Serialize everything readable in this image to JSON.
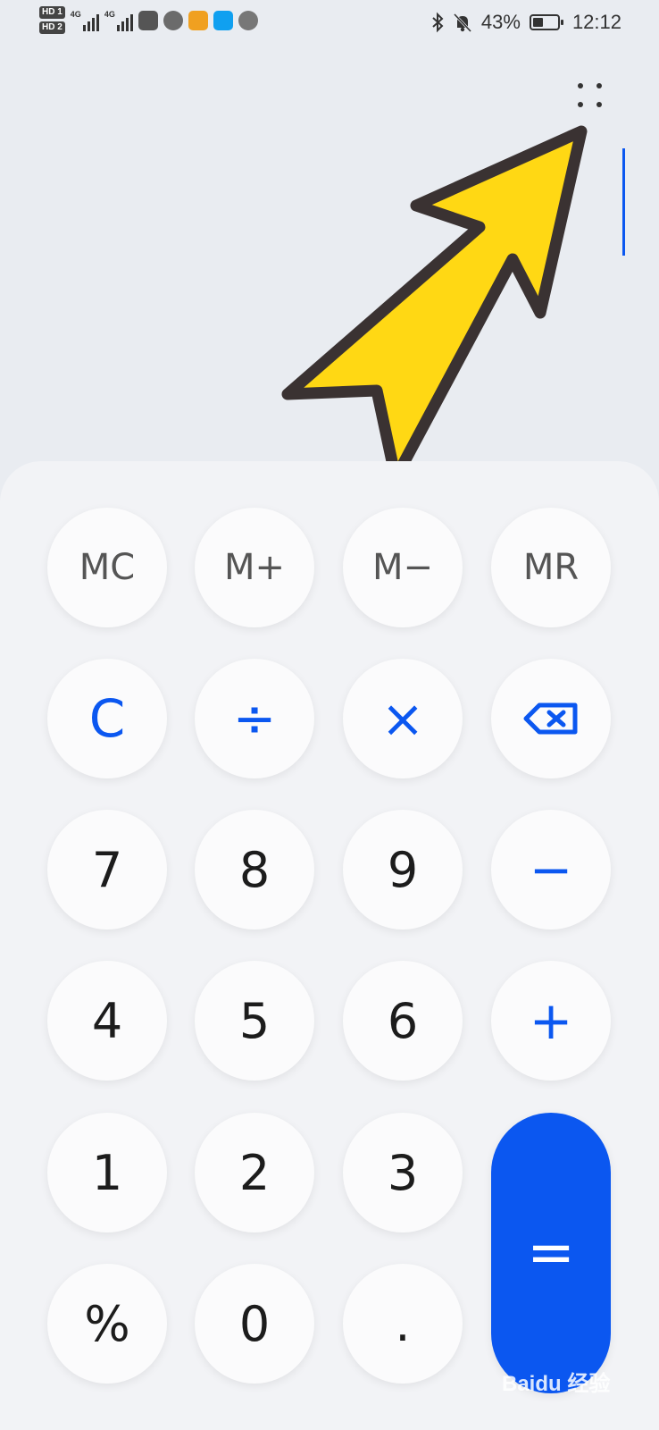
{
  "status_bar": {
    "sim1": "HD 1",
    "sim2": "HD 2",
    "net1": "4G",
    "net2": "4G",
    "battery_percent": "43%",
    "battery_level": 0.43,
    "time": "12:12",
    "icons": [
      "bluetooth-icon",
      "bell-muted-icon",
      "battery-charging-icon"
    ]
  },
  "display": {
    "expression": "",
    "more_icon": "more-options-icon"
  },
  "keys": {
    "mc": "MC",
    "m_plus": "M+",
    "m_minus": "M−",
    "mr": "MR",
    "clear": "C",
    "divide": "÷",
    "multiply": "×",
    "backspace_icon": "backspace-icon",
    "seven": "7",
    "eight": "8",
    "nine": "9",
    "minus": "−",
    "four": "4",
    "five": "5",
    "six": "6",
    "plus": "+",
    "one": "1",
    "two": "2",
    "three": "3",
    "equals": "=",
    "percent": "%",
    "zero": "0",
    "dot": "."
  },
  "watermark": "Baidu 经验",
  "colors": {
    "accent": "#0b57f0",
    "arrow_fill": "#ffd814",
    "background": "#e9ecf1"
  }
}
